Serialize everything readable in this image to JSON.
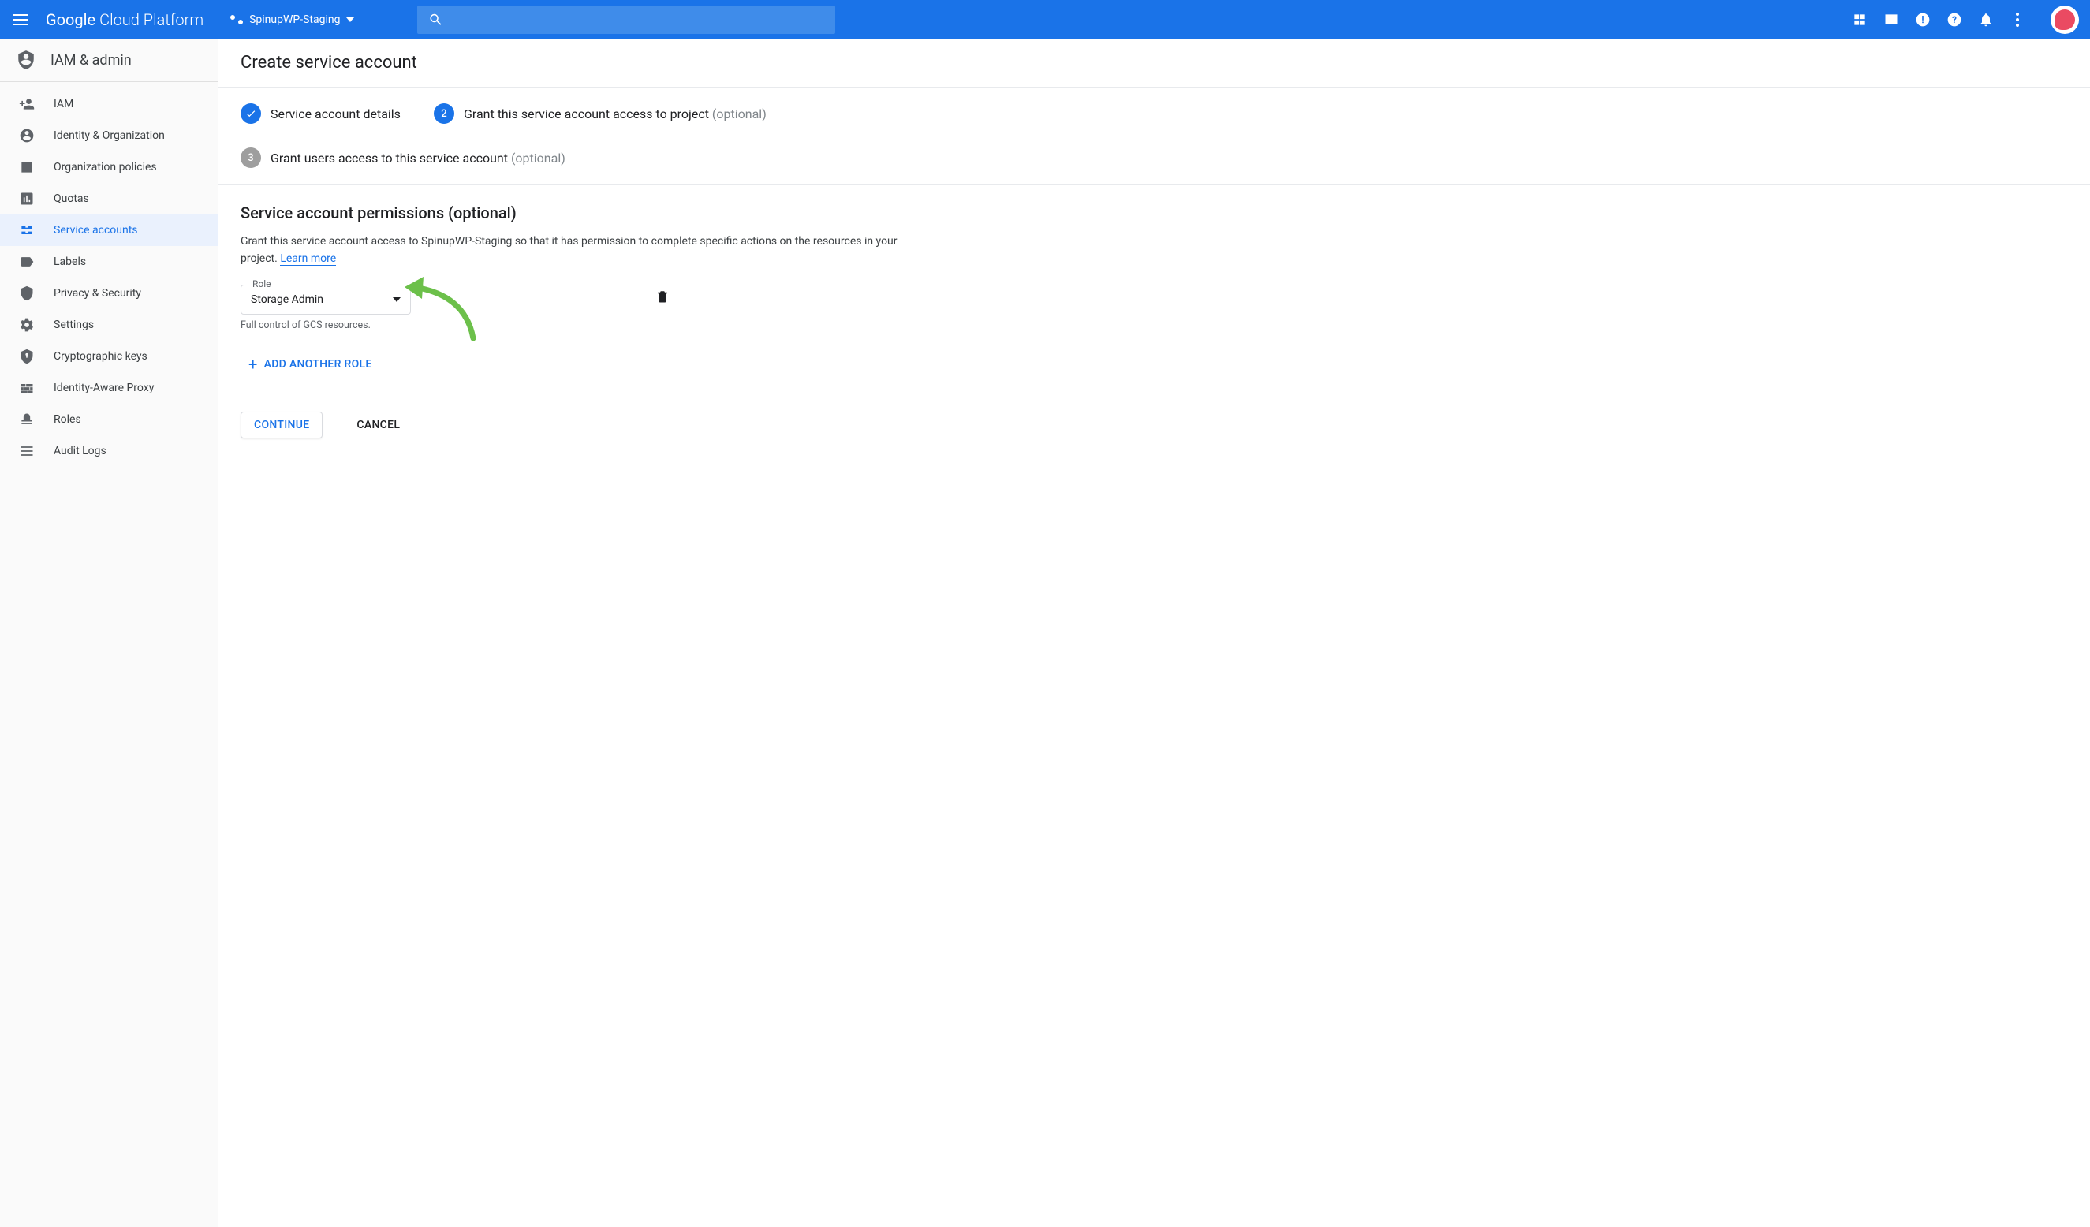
{
  "header": {
    "logo_left": "Google",
    "logo_right": "Cloud Platform",
    "project_name": "SpinupWP-Staging"
  },
  "sidebar": {
    "title": "IAM & admin",
    "items": [
      {
        "label": "IAM"
      },
      {
        "label": "Identity & Organization"
      },
      {
        "label": "Organization policies"
      },
      {
        "label": "Quotas"
      },
      {
        "label": "Service accounts"
      },
      {
        "label": "Labels"
      },
      {
        "label": "Privacy & Security"
      },
      {
        "label": "Settings"
      },
      {
        "label": "Cryptographic keys"
      },
      {
        "label": "Identity-Aware Proxy"
      },
      {
        "label": "Roles"
      },
      {
        "label": "Audit Logs"
      }
    ]
  },
  "page": {
    "title": "Create service account"
  },
  "stepper": {
    "step1": "Service account details",
    "step2": "Grant this service account access to project",
    "step2_num": "2",
    "step3": "Grant users access to this service account",
    "step3_num": "3",
    "optional": "(optional)"
  },
  "section": {
    "title": "Service account permissions (optional)",
    "desc_pre": "Grant this service account access to SpinupWP-Staging so that it has permission to complete specific actions on the resources in your project. ",
    "learn_more": "Learn more"
  },
  "role": {
    "label": "Role",
    "value": "Storage Admin",
    "desc": "Full control of GCS resources."
  },
  "actions": {
    "add_role": "ADD ANOTHER ROLE",
    "continue": "CONTINUE",
    "cancel": "CANCEL"
  }
}
